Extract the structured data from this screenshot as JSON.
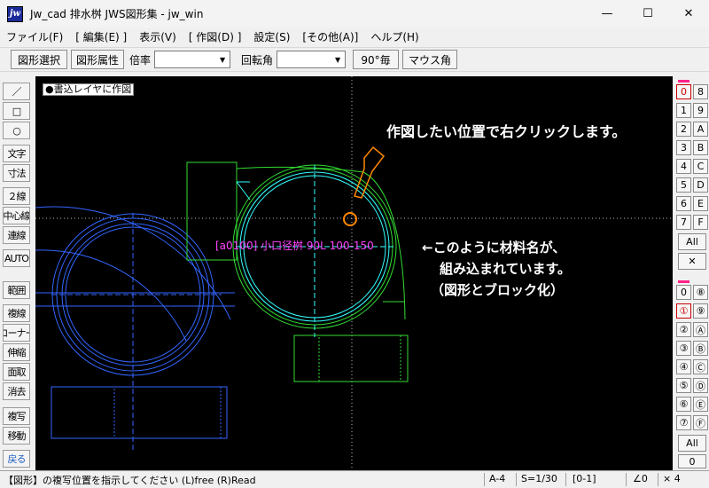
{
  "window": {
    "title": "Jw_cad 排水桝 JWS図形集        - jw_win",
    "logo": "jw",
    "controls": {
      "minimize": "—",
      "maximize": "☐",
      "close": "✕"
    }
  },
  "menu": [
    "ファイル(F)",
    "[ 編集(E) ]",
    "表示(V)",
    "[ 作図(D) ]",
    "設定(S)",
    "[その他(A)]",
    "ヘルプ(H)"
  ],
  "toolbar": {
    "select_figure": "図形選択",
    "figure_attr": "図形属性",
    "scale_label": "倍率",
    "scale_value": "",
    "rotation_label": "回転角",
    "rotation_value": "",
    "deg90": "90°毎",
    "mouse_angle": "マウス角"
  },
  "left_tools": [
    "／",
    "□",
    "○",
    "文字",
    "寸法",
    "２線",
    "中心線",
    "連線",
    "AUTO",
    "範囲",
    "複線",
    "コーナー",
    "伸縮",
    "面取",
    "消去",
    "複写",
    "移動",
    "戻る"
  ],
  "canvas": {
    "layer_label": "●書込レイヤに作図",
    "callout_click": "作図したい位置で右クリックします。",
    "callout_lines": [
      "←このように材料名が、",
      "組み込まれています。",
      "（図形とブロック化）"
    ],
    "part_label": "[a0100]  小口径桝 90L 100-150"
  },
  "right_panel": {
    "groups_top": [
      [
        "0",
        "8"
      ],
      [
        "1",
        "9"
      ],
      [
        "2",
        "A"
      ],
      [
        "3",
        "B"
      ],
      [
        "4",
        "C"
      ],
      [
        "5",
        "D"
      ],
      [
        "6",
        "E"
      ],
      [
        "7",
        "F"
      ]
    ],
    "all_top": "All",
    "close_top": "✕",
    "groups_bottom": [
      [
        "0",
        "⑧"
      ],
      [
        "①",
        "⑨"
      ],
      [
        "②",
        "Ⓐ"
      ],
      [
        "③",
        "Ⓑ"
      ],
      [
        "④",
        "Ⓒ"
      ],
      [
        "⑤",
        "Ⓓ"
      ],
      [
        "⑥",
        "Ⓔ"
      ],
      [
        "⑦",
        "Ⓕ"
      ]
    ],
    "all_bottom": "All",
    "zero_bottom": "0"
  },
  "status": {
    "message": "【図形】の複写位置を指示してください (L)free (R)Read",
    "paper": "A-4",
    "scale": "S=1/30",
    "layer": "[0-1]",
    "angle": "∠0",
    "zoom": "× 4"
  },
  "colors": {
    "canvas_bg": "#000000",
    "green": "#33dd33",
    "blue": "#3366ff",
    "cyan": "#33ffff",
    "magenta_text": "#ff44ff",
    "highlight": "#ff8800"
  }
}
